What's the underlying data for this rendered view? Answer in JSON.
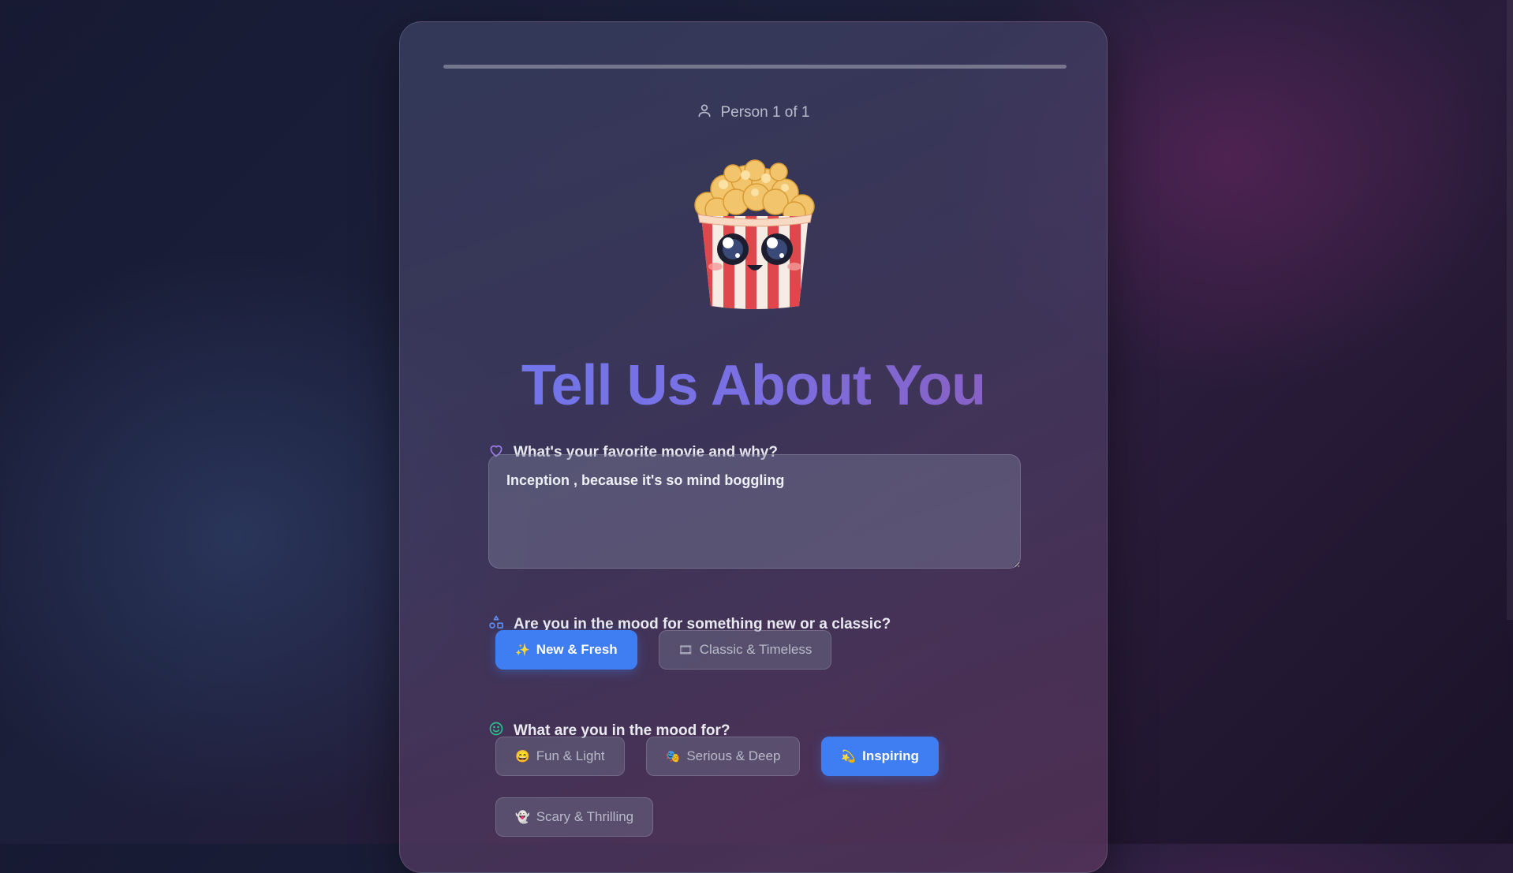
{
  "progress": {
    "fraction": 1.0
  },
  "person_indicator": {
    "label": "Person 1 of 1",
    "icon": "user-icon"
  },
  "mascot": {
    "icon": "popcorn-mascot"
  },
  "title": "Tell Us About You",
  "q1": {
    "icon": "heart-icon",
    "icon_color": "#a07bf0",
    "text": "What's your favorite movie and why?",
    "answer": "Inception , because it's so mind boggling"
  },
  "q2": {
    "icon": "shapes-icon",
    "icon_color": "#5b8ff5",
    "text": "Are you in the mood for something new or a classic?",
    "options": [
      {
        "emoji": "✨",
        "label": "New & Fresh",
        "selected": true
      },
      {
        "emoji": "🎞",
        "label": "Classic & Timeless",
        "selected": false
      }
    ]
  },
  "q3": {
    "icon": "smile-icon",
    "icon_color": "#2fbf8f",
    "text": "What are you in the mood for?",
    "options": [
      {
        "emoji": "😄",
        "label": "Fun & Light",
        "selected": false
      },
      {
        "emoji": "🎭",
        "label": "Serious & Deep",
        "selected": false
      },
      {
        "emoji": "💫",
        "label": "Inspiring",
        "selected": true
      },
      {
        "emoji": "👻",
        "label": "Scary & Thrilling",
        "selected": false
      }
    ]
  },
  "colors": {
    "accent": "#3f7df3"
  }
}
